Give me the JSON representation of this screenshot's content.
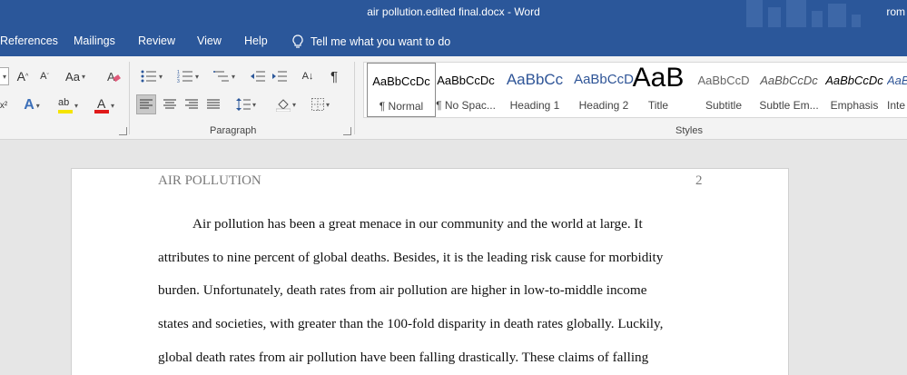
{
  "window": {
    "title": "air pollution.edited final.docx  -  Word",
    "user": "rom"
  },
  "tabs": [
    "References",
    "Mailings",
    "Review",
    "View",
    "Help"
  ],
  "tell_me": "Tell me what you want to do",
  "ribbon": {
    "paragraph_label": "Paragraph",
    "styles_label": "Styles",
    "font_size_up": "A",
    "font_size_down": "A",
    "change_case": "Aa",
    "text_effects": "A",
    "highlight": "ab",
    "font_color": "A",
    "sort": "A↓",
    "pilcrow": "¶",
    "superscript": "x²"
  },
  "styles": [
    {
      "preview": "AaBbCcDc",
      "name": "¶ Normal",
      "selected": true
    },
    {
      "preview": "AaBbCcDc",
      "name": "¶ No Spac..."
    },
    {
      "preview": "AaBbCc",
      "name": "Heading 1"
    },
    {
      "preview": "AaBbCcD",
      "name": "Heading 2"
    },
    {
      "preview": "AaB",
      "name": "Title"
    },
    {
      "preview": "AaBbCcD",
      "name": "Subtitle"
    },
    {
      "preview": "AaBbCcDc",
      "name": "Subtle Em..."
    },
    {
      "preview": "AaBbCcDc",
      "name": "Emphasis"
    },
    {
      "preview": "AaBbCcDc",
      "name": "Inte"
    }
  ],
  "document": {
    "header": "AIR POLLUTION",
    "page_number": "2",
    "lines": [
      "Air pollution has been a great menace in our community and the world at large.  It",
      "attributes to nine percent of global deaths. Besides, it is the leading risk cause for morbidity",
      "burden. Unfortunately, death rates from air pollution are higher in low-to-middle income",
      "states and societies, with greater than the 100-fold disparity in death rates globally. Luckily,",
      "global death rates from air pollution have been falling drastically. These claims of falling"
    ]
  }
}
